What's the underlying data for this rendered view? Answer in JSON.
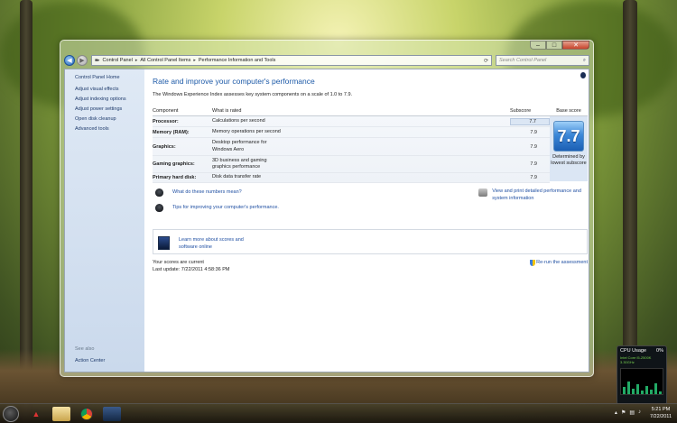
{
  "window": {
    "breadcrumbs": [
      "Control Panel",
      "All Control Panel Items",
      "Performance Information and Tools"
    ],
    "search_placeholder": "Search Control Panel"
  },
  "sidebar": {
    "home": "Control Panel Home",
    "tasks": [
      {
        "label": "Adjust visual effects"
      },
      {
        "label": "Adjust indexing options"
      },
      {
        "label": "Adjust power settings"
      },
      {
        "label": "Open disk cleanup"
      },
      {
        "label": "Advanced tools"
      }
    ],
    "see_also_heading": "See also",
    "see_also_items": [
      {
        "label": "Action Center"
      }
    ]
  },
  "main": {
    "title": "Rate and improve your computer's performance",
    "intro": "The Windows Experience Index assesses key system components on a scale of 1.0 to 7.9.",
    "table": {
      "headers": {
        "component": "Component",
        "what": "What is rated",
        "subscore": "Subscore",
        "base": "Base score"
      },
      "rows": [
        {
          "component": "Processor:",
          "what": "Calculations per second",
          "subscore": "7.7"
        },
        {
          "component": "Memory (RAM):",
          "what": "Memory operations per second",
          "subscore": "7.9"
        },
        {
          "component": "Graphics:",
          "what": "Desktop performance for Windows Aero",
          "subscore": "7.9"
        },
        {
          "component": "Gaming graphics:",
          "what": "3D business and gaming graphics performance",
          "subscore": "7.9"
        },
        {
          "component": "Primary hard disk:",
          "what": "Disk data transfer rate",
          "subscore": "7.9"
        }
      ],
      "base_score": "7.7",
      "base_caption": "Determined by lowest subscore"
    },
    "links": {
      "numbers": "What do these numbers mean?",
      "tips": "Tips for improving your computer's performance.",
      "print": "View and print detailed performance and system information",
      "learn": "Learn more about scores and software online"
    },
    "status": {
      "current": "Your scores are current",
      "last_update": "Last update: 7/22/2011 4:58:36 PM",
      "rerun": "Re-run the assessment"
    }
  },
  "gadget": {
    "title": "CPU Usage",
    "value": "0%",
    "subtitle": "Intel Core i5-2500K 3.30GHz"
  },
  "taskbar": {
    "time": "5:21 PM",
    "date": "7/22/2011"
  },
  "colors": {
    "link": "#1f4fa2",
    "title": "#1d5aa8",
    "sidebar_bg": "#dfe9f5",
    "score_badge": "#3c88d8"
  }
}
